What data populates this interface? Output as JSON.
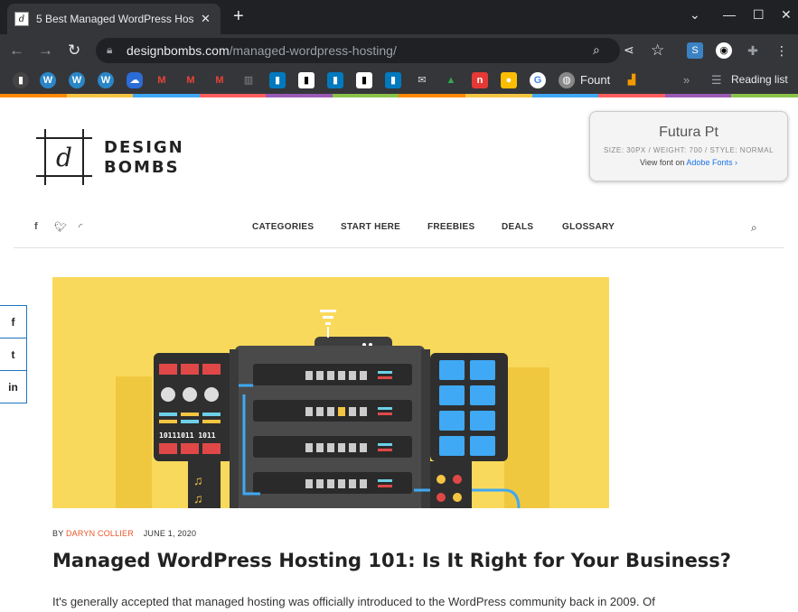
{
  "browser": {
    "tab_title": "5 Best Managed WordPress Hos",
    "tab_close": "✕",
    "new_tab": "+",
    "url_host": "designbombs.com",
    "url_path": "/managed-wordpress-hosting/",
    "bookmark_fount_label": "Fount",
    "reading_list_label": "Reading list",
    "more_bookmarks": "»"
  },
  "site": {
    "logo_letter": "d",
    "logo_line1": "DESIGN",
    "logo_line2": "BOMBS"
  },
  "font_popup": {
    "font_name": "Futura Pt",
    "meta": "SIZE: 30PX / WEIGHT: 700 / STYLE: NORMAL",
    "view_prefix": "View font on ",
    "view_link": "Adobe Fonts ›"
  },
  "nav": {
    "items": [
      "CATEGORIES",
      "START HERE",
      "FREEBIES",
      "DEALS",
      "GLOSSARY"
    ]
  },
  "share": {
    "facebook": "f",
    "twitter": "t",
    "linkedin": "in"
  },
  "article": {
    "by": "BY ",
    "author": "DARYN COLLIER",
    "date": "JUNE 1, 2020",
    "title": "Managed WordPress Hosting 101: Is It Right for Your Business?",
    "excerpt": "It's generally accepted that managed hosting was officially introduced to the WordPress community back in 2009. Of"
  },
  "hero_image": {
    "binary_text": "10111011 1011"
  },
  "colors": {
    "accent": "#e8562a",
    "link": "#1a73e8",
    "hero_bg": "#f9d95b"
  }
}
